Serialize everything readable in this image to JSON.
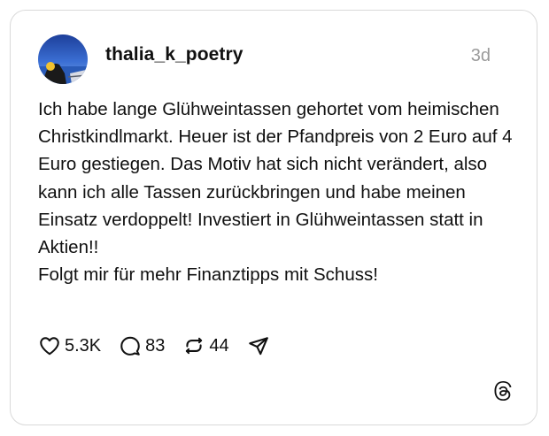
{
  "post": {
    "username": "thalia_k_poetry",
    "timestamp": "3d",
    "paragraphs": [
      "Ich habe lange Glühweintassen gehortet vom heimischen Christkindlmarkt. Heuer ist der Pfandpreis von 2 Euro auf 4 Euro gestiegen. Das Motiv hat sich nicht verändert, also kann ich alle Tassen zurückbringen und habe meinen Einsatz verdoppelt! Investiert in Glühweintassen statt in Aktien!!",
      "Folgt mir für mehr Finanztipps mit Schuss!"
    ]
  },
  "actions": {
    "likes": "5.3K",
    "replies": "83",
    "reposts": "44"
  },
  "icons": {
    "like": "heart-icon",
    "reply": "comment-bubble-icon",
    "repost": "repost-arrows-icon",
    "share": "send-paper-plane-icon",
    "brand": "threads-logo-icon"
  },
  "colors": {
    "text": "#101010",
    "muted": "#9a9a9a",
    "border": "#d9d9d9"
  }
}
